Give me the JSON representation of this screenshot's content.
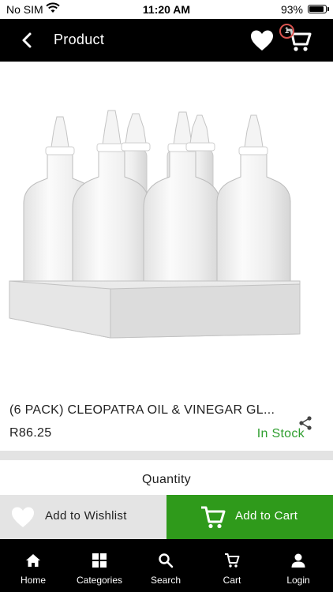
{
  "status_bar": {
    "carrier": "No SIM",
    "time": "11:20 AM",
    "battery": "93%"
  },
  "header": {
    "title": "Product",
    "cart_count": "1"
  },
  "product": {
    "name": "(6 PACK) CLEOPATRA  OIL & VINEGAR GL...",
    "price": "R86.25",
    "stock": "In Stock",
    "stock_color": "#2e9e2e"
  },
  "quantity_label": "Quantity",
  "actions": {
    "wishlist": "Add to Wishlist",
    "cart": "Add to Cart",
    "cart_color": "#2f9a1b"
  },
  "nav": [
    {
      "label": "Home",
      "icon": "home-icon"
    },
    {
      "label": "Categories",
      "icon": "grid-icon"
    },
    {
      "label": "Search",
      "icon": "search-icon"
    },
    {
      "label": "Cart",
      "icon": "cart-icon"
    },
    {
      "label": "Login",
      "icon": "user-icon"
    }
  ]
}
